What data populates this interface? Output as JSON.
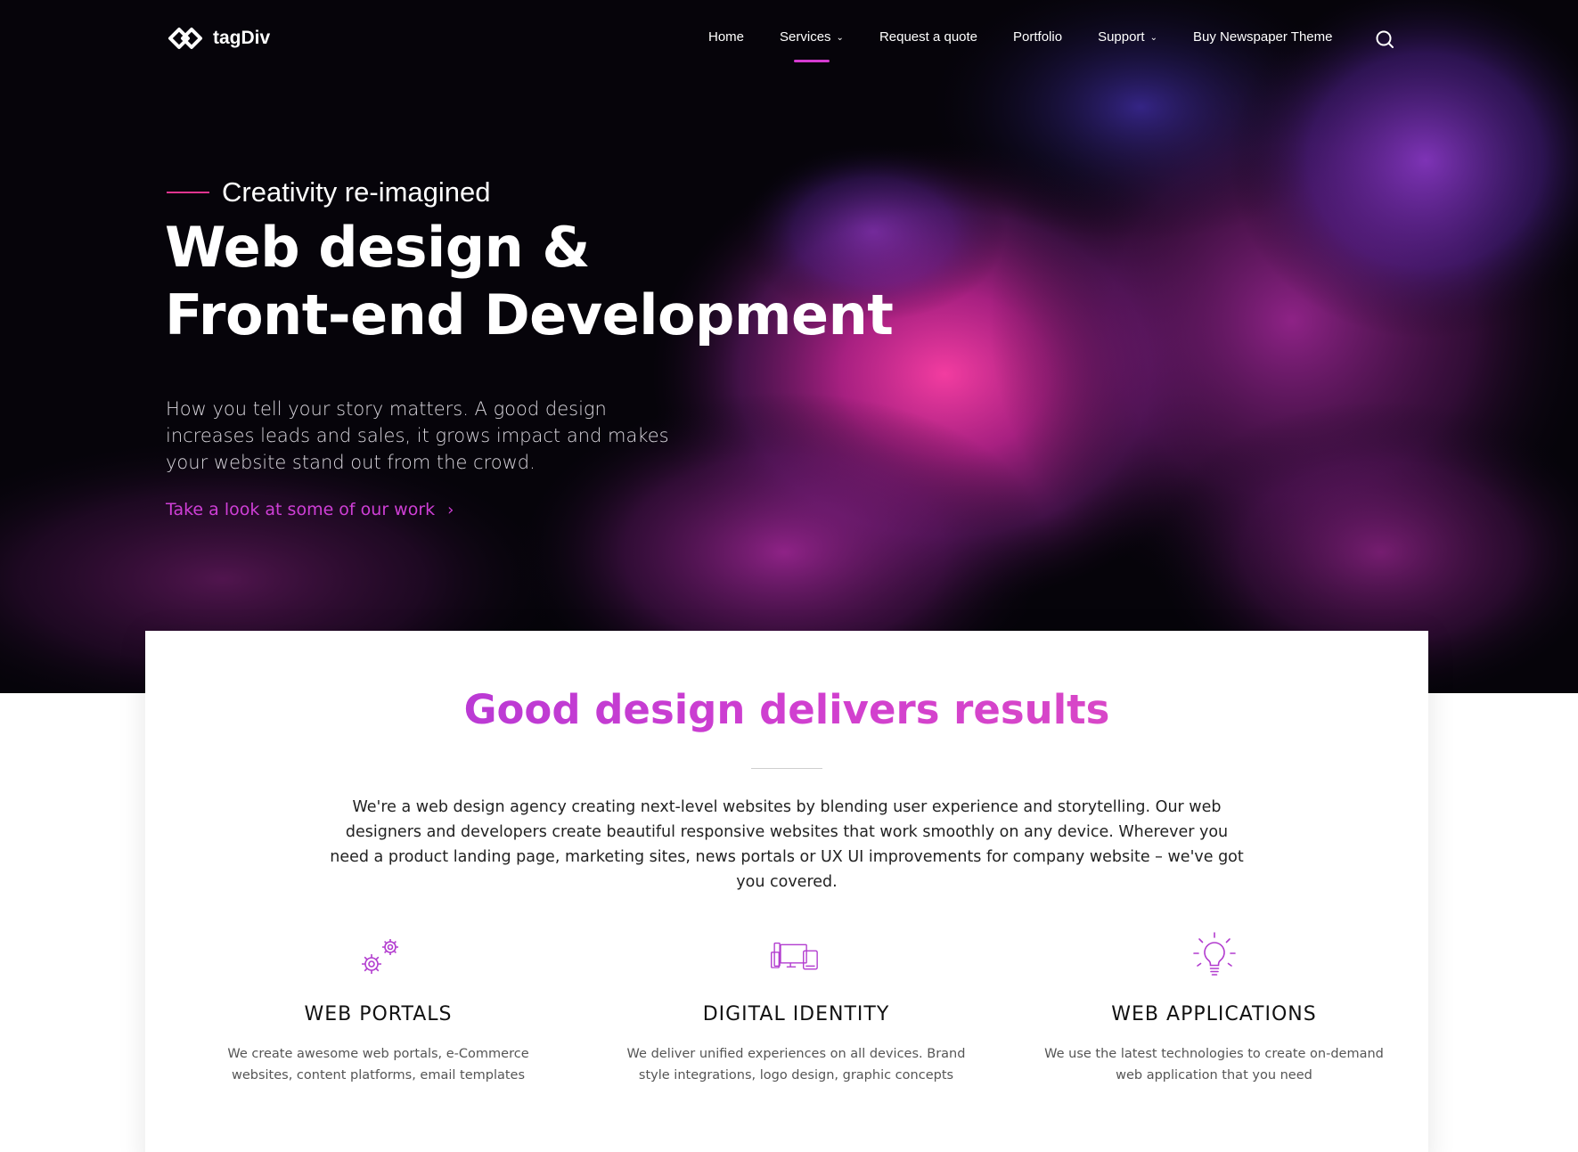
{
  "brand": {
    "name": "tagDiv",
    "accent": "#d43bd0",
    "accent_pink": "#e0348f",
    "hero_bg": "#06040a"
  },
  "nav": {
    "items": [
      {
        "label": "Home",
        "has_dropdown": false,
        "active": false
      },
      {
        "label": "Services",
        "has_dropdown": true,
        "active": true
      },
      {
        "label": "Request a quote",
        "has_dropdown": false,
        "active": false
      },
      {
        "label": "Portfolio",
        "has_dropdown": false,
        "active": false
      },
      {
        "label": "Support",
        "has_dropdown": true,
        "active": false
      },
      {
        "label": "Buy Newspaper Theme",
        "has_dropdown": false,
        "active": false
      }
    ],
    "search_icon": "search-icon"
  },
  "hero": {
    "tagline": "Creativity re-imagined",
    "headline_line1": "Web design &",
    "headline_line2": "Front-end Development",
    "intro": "How you tell your story matters. A good design increases leads and sales, it grows impact and makes your website stand out from the crowd.",
    "cta": "Take a look at some of our work"
  },
  "section": {
    "title": "Good design delivers results",
    "text": "We're a web design agency creating next-level websites by blending user experience and storytelling. Our web designers and developers create beautiful responsive websites that work smoothly on any device. Wherever you need a product landing page, marketing sites, news portals or UX UI improvements for company website – we've got you covered."
  },
  "features": [
    {
      "icon": "gears-icon",
      "title": "WEB PORTALS",
      "desc": "We create awesome web portals, e-Commerce websites, content platforms, email templates"
    },
    {
      "icon": "devices-icon",
      "title": "DIGITAL IDENTITY",
      "desc": "We deliver unified experiences on all devices. Brand style integrations, logo design, graphic concepts"
    },
    {
      "icon": "lightbulb-icon",
      "title": "WEB APPLICATIONS",
      "desc": "We use the latest technologies to create on-demand web application that you need"
    }
  ]
}
